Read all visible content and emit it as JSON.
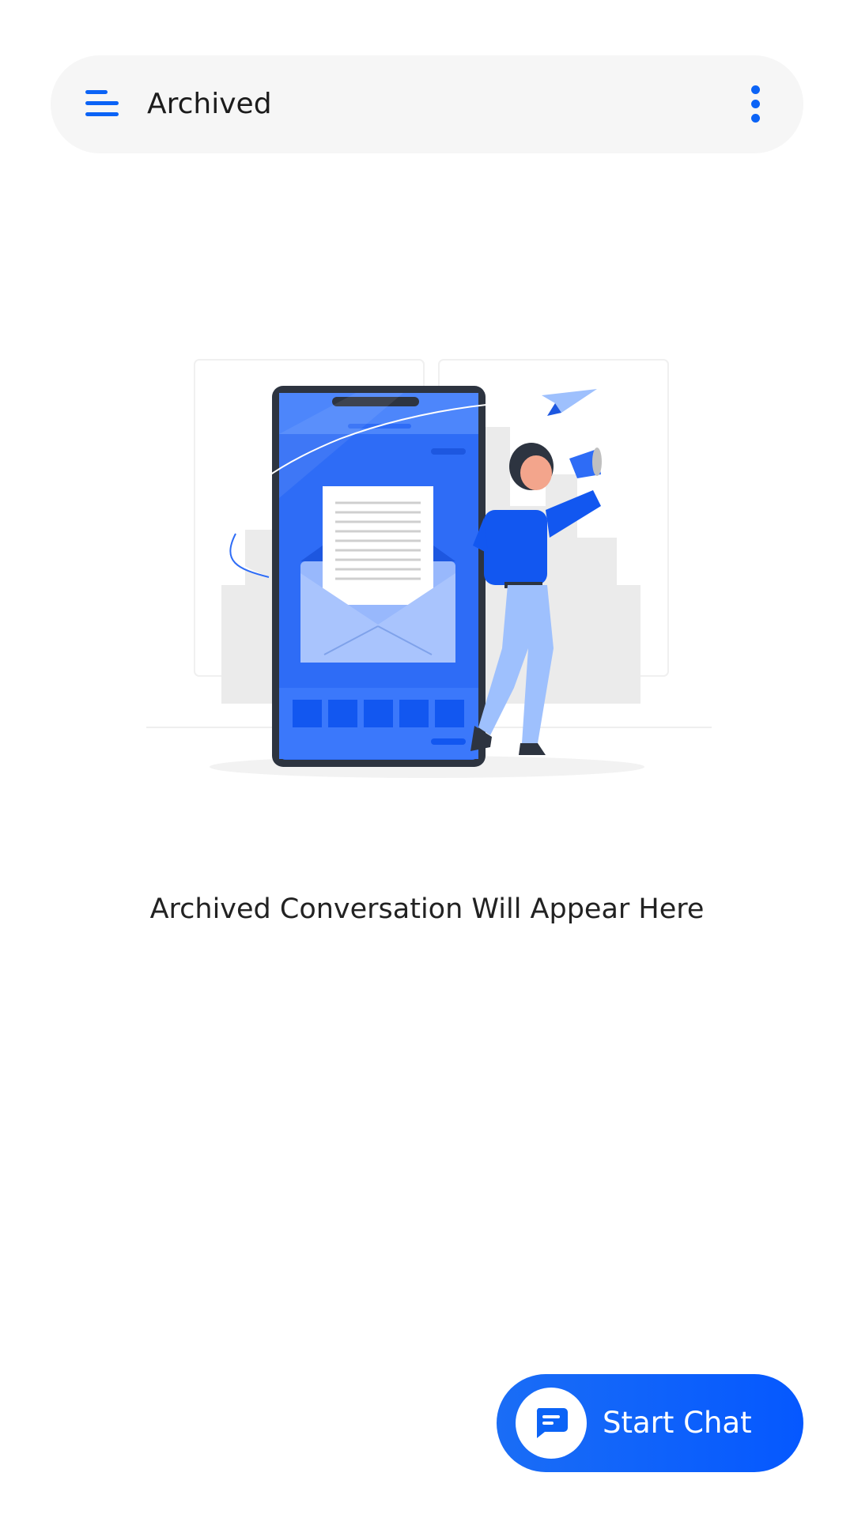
{
  "header": {
    "title": "Archived",
    "menu_icon": "menu-icon",
    "more_icon": "more-vertical-icon"
  },
  "empty_state": {
    "message": "Archived Conversation Will Appear Here",
    "illustration": "phone-mail-megaphone-illustration"
  },
  "fab": {
    "label": "Start Chat",
    "icon": "chat-bubble-icon"
  },
  "colors": {
    "accent": "#0b63f6",
    "header_bg": "#f6f6f6",
    "text": "#1c1c1c"
  }
}
